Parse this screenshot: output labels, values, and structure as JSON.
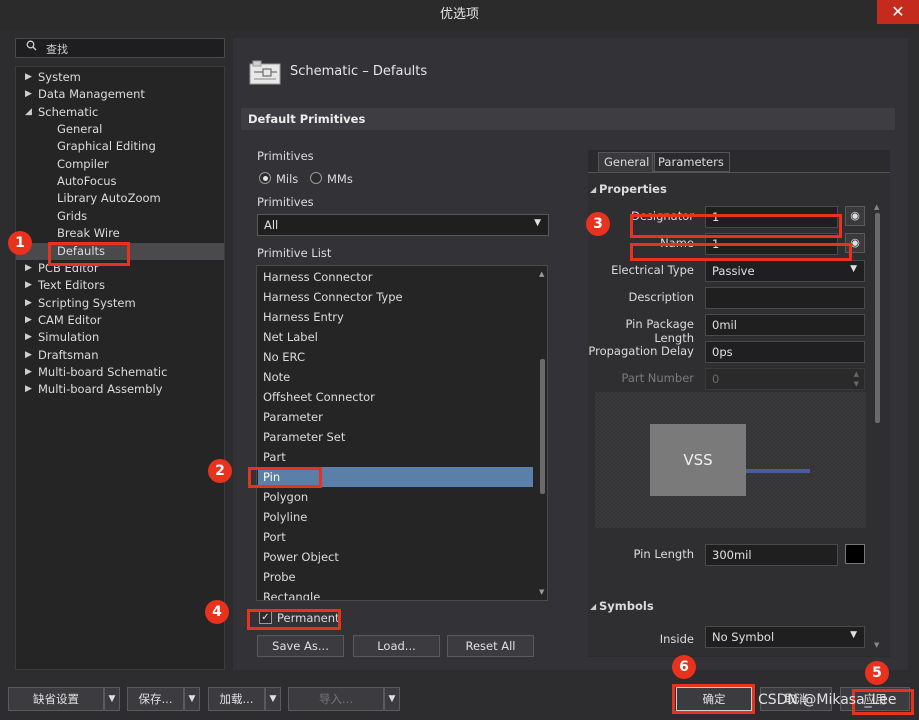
{
  "window": {
    "title": "优选项",
    "close": "✕"
  },
  "search": {
    "icon": "search-icon",
    "placeholder": "查找"
  },
  "tree": [
    {
      "label": "System",
      "arrow": "▶"
    },
    {
      "label": "Data Management",
      "arrow": "▶"
    },
    {
      "label": "Schematic",
      "arrow": "◢"
    },
    {
      "label": "General"
    },
    {
      "label": "Graphical Editing"
    },
    {
      "label": "Compiler"
    },
    {
      "label": "AutoFocus"
    },
    {
      "label": "Library AutoZoom"
    },
    {
      "label": "Grids"
    },
    {
      "label": "Break Wire"
    },
    {
      "label": "Defaults",
      "selected": true
    },
    {
      "label": "PCB Editor",
      "arrow": "▶"
    },
    {
      "label": "Text Editors",
      "arrow": "▶"
    },
    {
      "label": "Scripting System",
      "arrow": "▶"
    },
    {
      "label": "CAM Editor",
      "arrow": "▶"
    },
    {
      "label": "Simulation",
      "arrow": "▶"
    },
    {
      "label": "Draftsman",
      "arrow": "▶"
    },
    {
      "label": "Multi-board Schematic",
      "arrow": "▶"
    },
    {
      "label": "Multi-board Assembly",
      "arrow": "▶"
    }
  ],
  "page": {
    "title": "Schematic – Defaults",
    "section": "Default Primitives"
  },
  "units": {
    "label": "Primitives",
    "options": [
      "Mils",
      "MMs"
    ],
    "selected": "Mils"
  },
  "filter": {
    "label": "Primitives",
    "value": "All"
  },
  "primitive_list": {
    "label": "Primitive List",
    "items": [
      "Harness Connector",
      "Harness Connector Type",
      "Harness Entry",
      "Net Label",
      "No ERC",
      "Note",
      "Offsheet Connector",
      "Parameter",
      "Parameter Set",
      "Part",
      "Pin",
      "Polygon",
      "Polyline",
      "Port",
      "Power Object",
      "Probe",
      "Rectangle"
    ],
    "selected": "Pin"
  },
  "permanent": {
    "label": "Permanent",
    "checked": true,
    "mark": "✓"
  },
  "buttons": {
    "save_as": "Save As...",
    "load": "Load...",
    "reset_all": "Reset All"
  },
  "tabs": [
    "General",
    "Parameters"
  ],
  "properties": {
    "header": "Properties",
    "designator_label": "Designator",
    "designator_value": "1",
    "name_label": "Name",
    "name_value": "1",
    "electrical_type_label": "Electrical Type",
    "electrical_type_value": "Passive",
    "description_label": "Description",
    "description_value": "",
    "pin_package_length_label": "Pin Package Length",
    "pin_package_length_value": "0mil",
    "propagation_delay_label": "Propagation Delay",
    "propagation_delay_value": "0ps",
    "part_number_label": "Part Number",
    "part_number_value": "0",
    "preview_text": "VSS",
    "pin_length_label": "Pin Length",
    "pin_length_value": "300mil",
    "pin_color": "#000000"
  },
  "symbols": {
    "header": "Symbols",
    "inside_label": "Inside",
    "inside_value": "No Symbol"
  },
  "bottom": {
    "defaults": "缺省设置",
    "save": "保存...",
    "load": "加载...",
    "import": "导入...",
    "ok": "确定",
    "cancel": "取消",
    "apply": "应用"
  },
  "watermark": "CSDN @Mikasa_Lee",
  "annotations": [
    "1",
    "2",
    "3",
    "4",
    "5",
    "6"
  ],
  "colors": {
    "annotation": "#e8321e",
    "selection": "#5a7fa8",
    "close": "#c42b1c"
  }
}
